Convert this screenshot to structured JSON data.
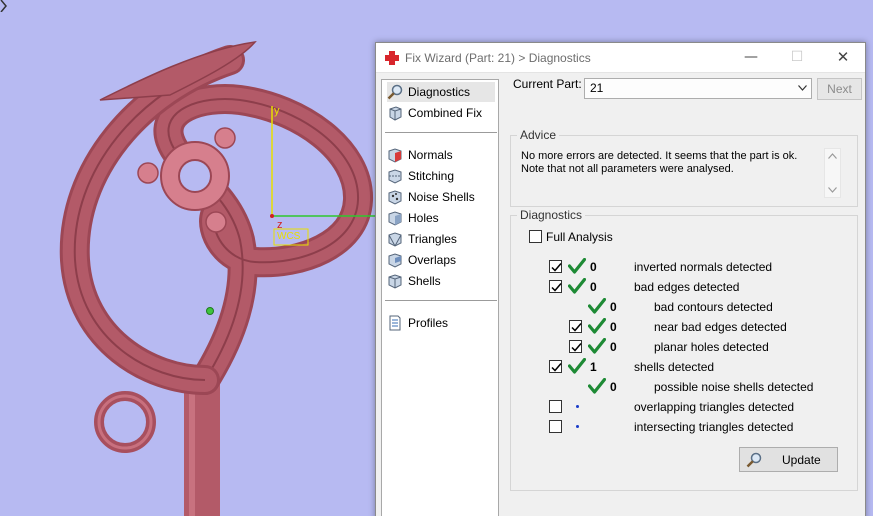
{
  "viewport": {
    "axis_y_label": "y",
    "axis_z_label": "z",
    "wcs_label": "WCS",
    "part_color": "#b35a68",
    "background_color": "#b7baf2"
  },
  "dialog": {
    "title": "Fix Wizard (Part: 21) > Diagnostics",
    "app_icon": "red-cross-icon",
    "controls": {
      "minimize": "—",
      "maximize": "☐",
      "close": "✕"
    }
  },
  "nav": {
    "items": [
      {
        "label": "Diagnostics",
        "icon": "magnifier-icon",
        "selected": true
      },
      {
        "label": "Combined Fix",
        "icon": "cubes-icon"
      },
      {
        "label": "Normals",
        "icon": "normals-cube-icon"
      },
      {
        "label": "Stitching",
        "icon": "stitching-cube-icon"
      },
      {
        "label": "Noise Shells",
        "icon": "noise-shells-icon"
      },
      {
        "label": "Holes",
        "icon": "holes-cube-icon"
      },
      {
        "label": "Triangles",
        "icon": "triangles-cube-icon"
      },
      {
        "label": "Overlaps",
        "icon": "overlaps-cube-icon"
      },
      {
        "label": "Shells",
        "icon": "shells-cube-icon"
      },
      {
        "label": "Profiles",
        "icon": "document-icon"
      }
    ]
  },
  "current_part": {
    "label": "Current Part:",
    "value": "21",
    "next_label": "Next"
  },
  "advice": {
    "title": "Advice",
    "line1": "No more errors are detected. It seems that the part is ok.",
    "line2": "Note that not all parameters were analysed."
  },
  "diagnostics": {
    "title": "Diagnostics",
    "full_analysis_label": "Full Analysis",
    "full_analysis_checked": false,
    "rows": [
      {
        "checked": true,
        "status": "ok",
        "count": "0",
        "label": "inverted normals detected",
        "indent": 0,
        "has_checkbox": true
      },
      {
        "checked": true,
        "status": "ok",
        "count": "0",
        "label": "bad edges detected",
        "indent": 0,
        "has_checkbox": true
      },
      {
        "checked": false,
        "status": "ok",
        "count": "0",
        "label": "bad contours detected",
        "indent": 1,
        "has_checkbox": false
      },
      {
        "checked": true,
        "status": "ok",
        "count": "0",
        "label": "near bad edges detected",
        "indent": 1,
        "has_checkbox": true
      },
      {
        "checked": true,
        "status": "ok",
        "count": "0",
        "label": "planar holes detected",
        "indent": 1,
        "has_checkbox": true
      },
      {
        "checked": true,
        "status": "ok",
        "count": "1",
        "label": "shells detected",
        "indent": 0,
        "has_checkbox": true
      },
      {
        "checked": false,
        "status": "ok",
        "count": "0",
        "label": "possible noise shells detected",
        "indent": 1,
        "has_checkbox": false
      },
      {
        "checked": false,
        "status": "none",
        "count": "",
        "label": "overlapping triangles detected",
        "indent": 0,
        "has_checkbox": true
      },
      {
        "checked": false,
        "status": "none",
        "count": "",
        "label": "intersecting triangles detected",
        "indent": 0,
        "has_checkbox": true
      }
    ],
    "update_label": "Update"
  }
}
